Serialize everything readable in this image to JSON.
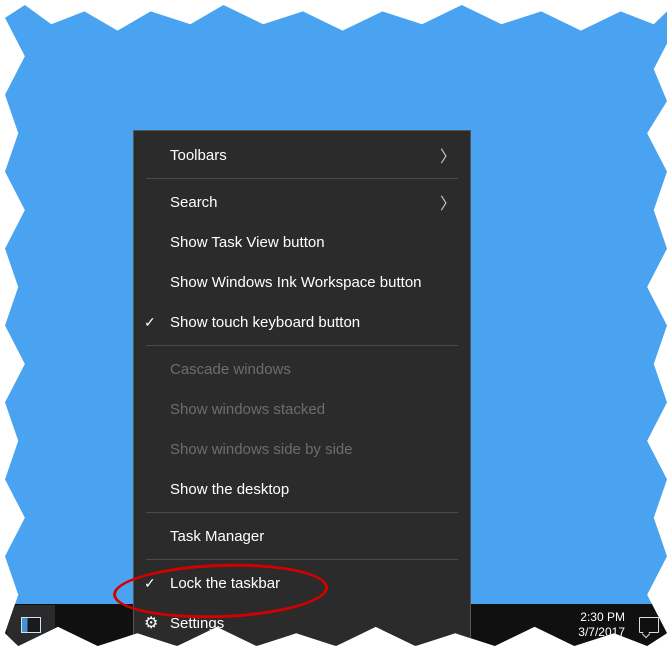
{
  "menu": {
    "toolbars": "Toolbars",
    "search": "Search",
    "show_task_view": "Show Task View button",
    "show_ink": "Show Windows Ink Workspace button",
    "show_touch_kb": "Show touch keyboard button",
    "cascade": "Cascade windows",
    "stacked": "Show windows stacked",
    "side_by_side": "Show windows side by side",
    "show_desktop": "Show the desktop",
    "task_manager": "Task Manager",
    "lock_taskbar": "Lock the taskbar",
    "settings": "Settings"
  },
  "taskbar": {
    "time": "2:30 PM",
    "date": "3/7/2017"
  },
  "highlight": {
    "target": "lock_taskbar",
    "color": "#d40000"
  }
}
